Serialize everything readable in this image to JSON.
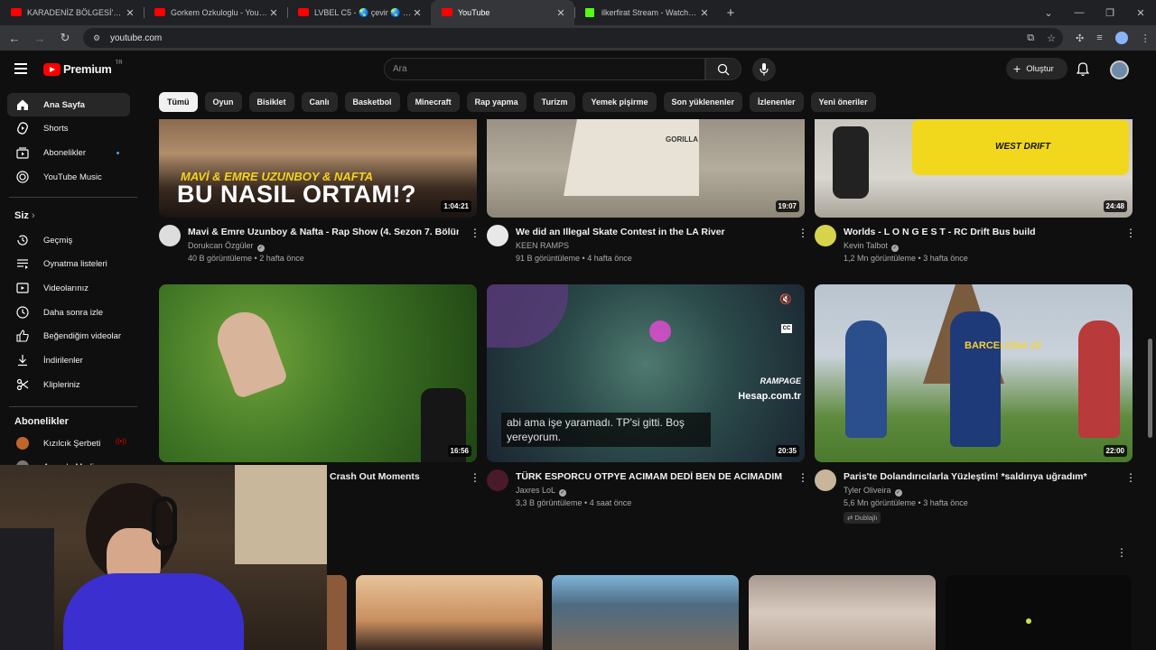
{
  "browser": {
    "tabs": [
      {
        "title": "KARADENİZ BÖLGESİ'NİN EN D",
        "favicon": "youtube-icon",
        "active": false
      },
      {
        "title": "Gorkem Ozkuloglu - YouTube",
        "favicon": "youtube-icon",
        "active": false
      },
      {
        "title": "LVBEL C5 - 🌏 çevir 🌏 - YouT",
        "favicon": "youtube-icon",
        "active": false
      },
      {
        "title": "YouTube",
        "favicon": "youtube-icon",
        "active": true
      },
      {
        "title": "ilkerfirat Stream - Watch Live o",
        "favicon": "kick-icon",
        "active": false
      }
    ],
    "url": "youtube.com"
  },
  "masthead": {
    "logo_text": "Premium",
    "logo_suffix": "TR",
    "search_placeholder": "Ara",
    "create_label": "Oluştur"
  },
  "sidebar": {
    "main": [
      {
        "label": "Ana Sayfa",
        "icon": "home-icon",
        "active": true
      },
      {
        "label": "Shorts",
        "icon": "shorts-icon"
      },
      {
        "label": "Abonelikler",
        "icon": "subscriptions-icon",
        "dot": true
      },
      {
        "label": "YouTube Music",
        "icon": "music-icon"
      }
    ],
    "you_heading": "Siz",
    "you": [
      {
        "label": "Geçmiş",
        "icon": "history-icon"
      },
      {
        "label": "Oynatma listeleri",
        "icon": "playlist-icon"
      },
      {
        "label": "Videolarınız",
        "icon": "your-videos-icon"
      },
      {
        "label": "Daha sonra izle",
        "icon": "watch-later-icon"
      },
      {
        "label": "Beğendiğim videolar",
        "icon": "like-icon"
      },
      {
        "label": "İndirilenler",
        "icon": "download-icon"
      },
      {
        "label": "Klipleriniz",
        "icon": "clips-icon"
      }
    ],
    "subs_heading": "Abonelikler",
    "subs": [
      {
        "label": "Kızılcık Şerbeti",
        "live": true
      },
      {
        "label": "Agonda Media"
      }
    ]
  },
  "chips": [
    "Tümü",
    "Oyun",
    "Bisiklet",
    "Canlı",
    "Basketbol",
    "Minecraft",
    "Rap yapma",
    "Turizm",
    "Yemek pişirme",
    "Son yüklenenler",
    "İzlenenler",
    "Yeni öneriler"
  ],
  "videos": [
    {
      "title": "Mavi & Emre Uzunboy & Nafta - Rap Show (4. Sezon 7. Bölüm)",
      "channel": "Dorukcan Özgüler",
      "verified": true,
      "views": "40 B görüntüleme",
      "age": "2 hafta önce",
      "duration": "1:04:21",
      "thumb_text_1": "MAVİ & EMRE UZUNBOY & NAFTA",
      "thumb_text_2": "BU NASIL ORTAM!?"
    },
    {
      "title": "We did an Illegal Skate Contest in the LA River",
      "channel": "KEEN RAMPS",
      "verified": false,
      "views": "91 B görüntüleme",
      "age": "4 hafta önce",
      "duration": "19:07",
      "thumb_text_1": "GORILLA"
    },
    {
      "title": "Worlds - L O N G E S T - RC Drift Bus build",
      "channel": "Kevin Talbot",
      "verified": true,
      "views": "1,2 Mn görüntüleme",
      "age": "3 hafta önce",
      "duration": "24:48",
      "thumb_text_1": "WEST DRIFT"
    },
    {
      "title": "Crash Out Moments",
      "channel": "",
      "verified": false,
      "views": "",
      "age": "",
      "duration": "16:56"
    },
    {
      "title": "TÜRK ESPORCU OTPYE ACIMAM DEDİ BEN DE ACIMADIM",
      "channel": "Jaxres LoL",
      "verified": true,
      "views": "3,3 B görüntüleme",
      "age": "4 saat önce",
      "duration": "20:35",
      "captions": "abi ama işe yaramadı. TP'si gitti. Boş yereyorum.",
      "thumb_text_1": "RAMPAGE",
      "thumb_text_2": "Hesap.com.tr"
    },
    {
      "title": "Paris'te Dolandırıcılarla Yüzleştim! *saldırıya uğradım*",
      "channel": "Tyler Oliveira",
      "verified": true,
      "views": "5,6 Mn görüntüleme",
      "age": "3 hafta önce",
      "duration": "22:00",
      "badge": "Dublajlı",
      "thumb_text_1": "BARCELONA 10"
    }
  ]
}
